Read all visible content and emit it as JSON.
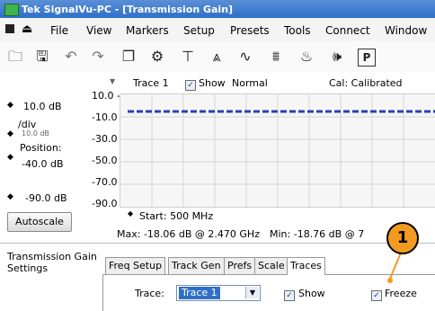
{
  "window": {
    "title": "Tek SignalVu-PC - [Transmission Gain]"
  },
  "menu": [
    "File",
    "View",
    "Markers",
    "Setup",
    "Presets",
    "Tools",
    "Connect",
    "Window"
  ],
  "toolbar_icons": [
    "open-folder-icon",
    "save-icon",
    "undo-icon",
    "redo-icon",
    "window-icon",
    "gear-icon",
    "trigger-icon",
    "spectrum-icon",
    "trace-icon",
    "measure-icon",
    "replay-icon",
    "audio-icon",
    "preset-icon"
  ],
  "trace_header": {
    "trace_label": "Trace 1",
    "show_label": "Show",
    "mode": "Normal",
    "cal": "Cal: Calibrated"
  },
  "left_panel": {
    "ref_level": "10.0 dB",
    "per_div_label": "/div",
    "per_div_value": "10.0 dB",
    "position_label": "Position:",
    "position_value": "-40.0 dB",
    "bottom_level": "-90.0 dB",
    "autoscale_label": "Autoscale"
  },
  "y_ticks": [
    "10.0 -",
    "-10.0 -",
    "-30.0 -",
    "-50.0 -",
    "-70.0 -",
    "-90.0 -"
  ],
  "start_label": "Start:  500 MHz",
  "max_label": "Max:  -18.06 dB @  2.470 GHz",
  "min_label": "Min:  -18.76 dB @  7",
  "bottom_panel": {
    "settings_title": "Transmission Gain Settings",
    "tabs": [
      "Freq Setup",
      "Track Gen",
      "Prefs",
      "Scale",
      "Traces"
    ],
    "trace_field_label": "Trace:",
    "trace_select_value": "Trace 1",
    "show_label": "Show",
    "freeze_label": "Freeze"
  },
  "callout_number": "1",
  "colors": {
    "title_bar": "#2f6fc8",
    "trace_line": "#2b3fb8",
    "callout": "#f39a20"
  }
}
